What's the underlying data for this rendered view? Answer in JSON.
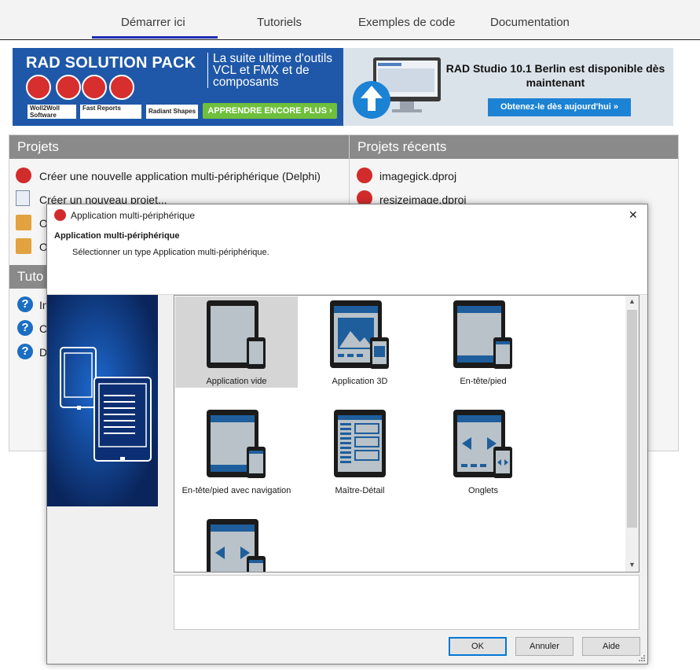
{
  "tabs": [
    "Démarrer ici",
    "Tutoriels",
    "Exemples de code",
    "Documentation"
  ],
  "banner": {
    "title": "RAD SOLUTION PACK",
    "subtitle": "La suite ultime d'outils VCL et FMX et de composants",
    "brands": [
      "Woll2Woll Software",
      "Fast Reports",
      "Radiant Shapes"
    ],
    "learn_more": "APPRENDRE ENCORE PLUS",
    "rs_text": "RAD Studio 10.1 Berlin est disponible dès maintenant",
    "get_button": "Obtenez-le dès aujourd'hui"
  },
  "projects": {
    "header": "Projets",
    "items": [
      "Créer une nouvelle application multi-périphérique (Delphi)",
      "Créer un nouveau projet...",
      "O",
      "O"
    ]
  },
  "recent": {
    "header": "Projets récents",
    "items": [
      "imagegick.dproj",
      "resizeimage.dproj"
    ]
  },
  "tutorials": {
    "header": "Tuto",
    "items": [
      "In",
      "C",
      "D"
    ]
  },
  "dialog": {
    "title": "Application multi-périphérique",
    "heading": "Application multi-périphérique",
    "subheading": "Sélectionner un type Application multi-périphérique.",
    "gallery": [
      {
        "label": "Application vide",
        "selected": true
      },
      {
        "label": "Application 3D",
        "selected": false
      },
      {
        "label": "En-tête/pied",
        "selected": false
      },
      {
        "label": "En-tête/pied avec navigation",
        "selected": false
      },
      {
        "label": "Maître-Détail",
        "selected": false
      },
      {
        "label": "Onglets",
        "selected": false
      },
      {
        "label": "",
        "selected": false
      }
    ],
    "buttons": {
      "ok": "OK",
      "cancel": "Annuler",
      "help": "Aide"
    },
    "close_glyph": "✕"
  }
}
